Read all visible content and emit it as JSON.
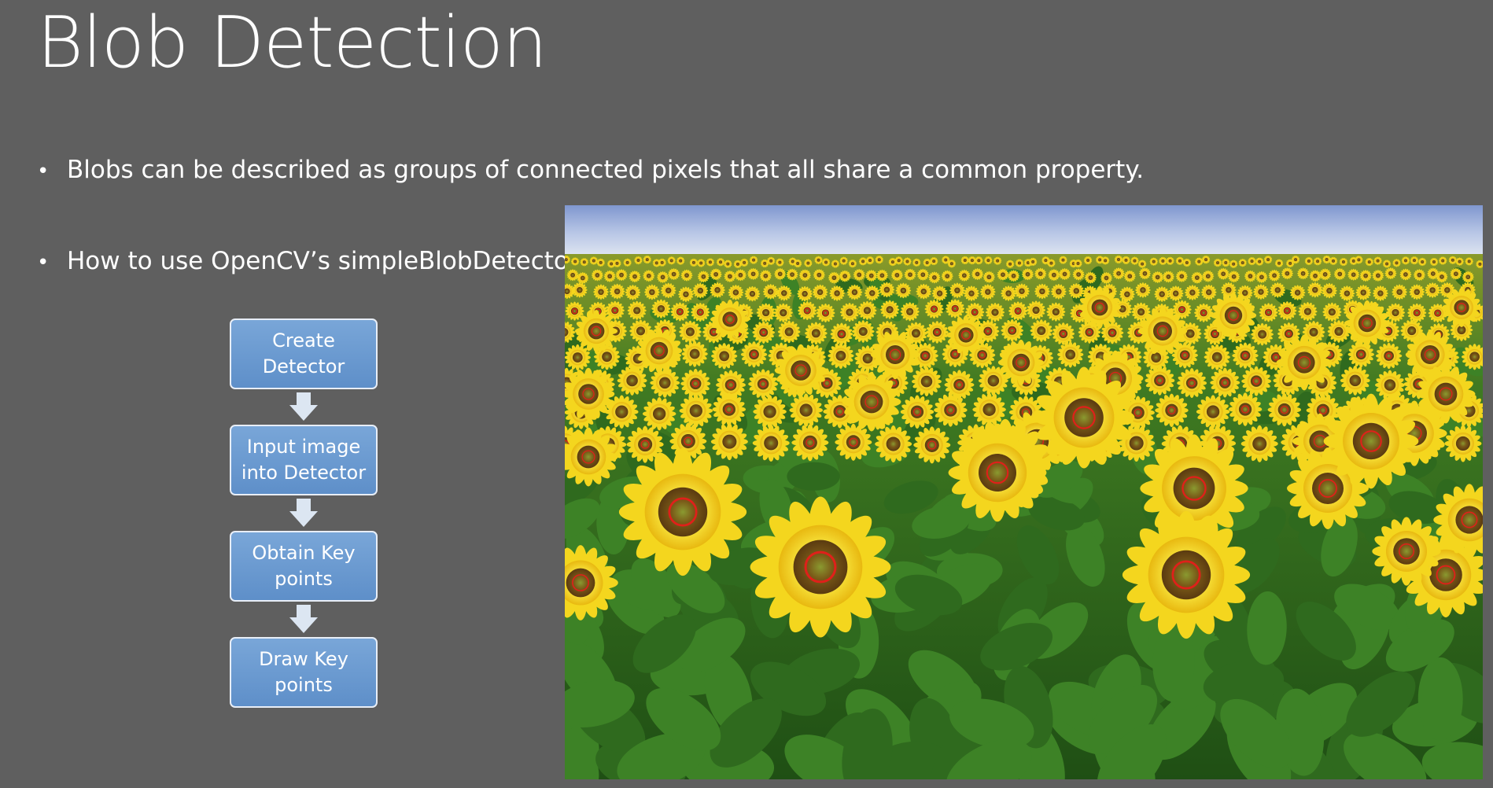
{
  "slide": {
    "title": "Blob Detection",
    "bullets": [
      "Blobs can be described as groups of connected pixels that all share a common property.",
      "How to use OpenCV’s simpleBlobDetector?"
    ],
    "bullet_glyph": "•"
  },
  "flowchart": {
    "steps": [
      "Create\nDetector",
      "Input image\ninto Detector",
      "Obtain Key\npoints",
      "Draw Key\npoints"
    ],
    "arrow_icon": "down-arrow-icon"
  },
  "photo": {
    "subject": "sunflower-field-icon",
    "keypoint_color": "#e0201a"
  },
  "colors": {
    "background": "#5f5f5f",
    "box_fill": "#6a9bd1",
    "box_border": "#e8eef7",
    "arrow_fill": "#dce6f2"
  }
}
